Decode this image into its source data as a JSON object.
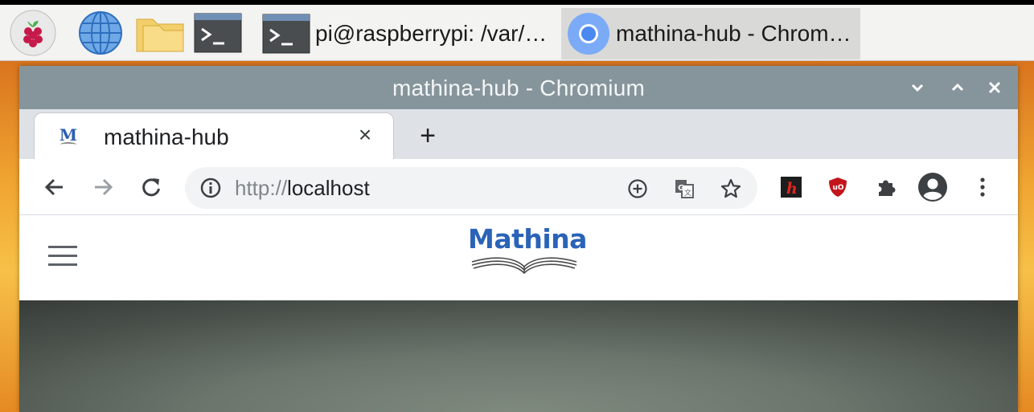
{
  "taskbar": {
    "launchers": [
      {
        "name": "raspberry-menu",
        "icon": "raspberry-icon"
      },
      {
        "name": "web-browser",
        "icon": "globe-icon"
      },
      {
        "name": "file-manager",
        "icon": "folder-icon"
      },
      {
        "name": "terminal",
        "icon": "terminal-icon"
      }
    ],
    "tasks": [
      {
        "label": "pi@raspberrypi: /var/…",
        "icon": "terminal-icon"
      },
      {
        "label": "mathina-hub - Chrom…",
        "icon": "chromium-icon",
        "active": true
      }
    ]
  },
  "window": {
    "title": "mathina-hub - Chromium",
    "controls": [
      "minimize",
      "maximize",
      "close"
    ]
  },
  "tabs": [
    {
      "title": "mathina-hub",
      "favicon_letter": "M",
      "close": "×"
    }
  ],
  "new_tab_label": "+",
  "toolbar": {
    "url_scheme": "http://",
    "url_host": "localhost"
  },
  "page": {
    "logo_text": "Mathina"
  },
  "colors": {
    "titlebar": "#86959c",
    "tabstrip": "#dee1e6",
    "logo": "#2a63b8",
    "wallpaper": "#f0a531"
  }
}
